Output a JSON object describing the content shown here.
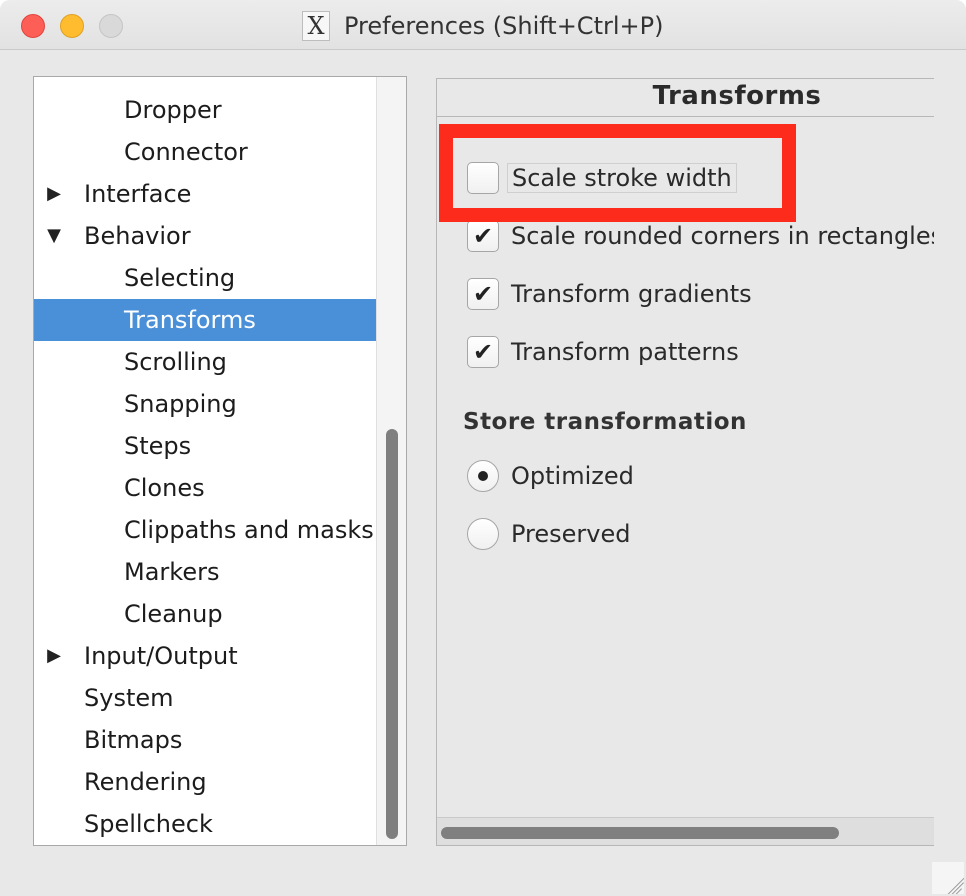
{
  "window": {
    "title": "Preferences (Shift+Ctrl+P)",
    "app_icon_glyph": "X"
  },
  "tree": {
    "items": [
      {
        "label": "Dropper",
        "indent": 2,
        "arrow": "",
        "selected": false
      },
      {
        "label": "Connector",
        "indent": 2,
        "arrow": "",
        "selected": false
      },
      {
        "label": "Interface",
        "indent": 1,
        "arrow": "collapsed",
        "selected": false
      },
      {
        "label": "Behavior",
        "indent": 1,
        "arrow": "expanded",
        "selected": false
      },
      {
        "label": "Selecting",
        "indent": 2,
        "arrow": "",
        "selected": false
      },
      {
        "label": "Transforms",
        "indent": 2,
        "arrow": "",
        "selected": true
      },
      {
        "label": "Scrolling",
        "indent": 2,
        "arrow": "",
        "selected": false
      },
      {
        "label": "Snapping",
        "indent": 2,
        "arrow": "",
        "selected": false
      },
      {
        "label": "Steps",
        "indent": 2,
        "arrow": "",
        "selected": false
      },
      {
        "label": "Clones",
        "indent": 2,
        "arrow": "",
        "selected": false
      },
      {
        "label": "Clippaths and masks",
        "indent": 2,
        "arrow": "",
        "selected": false
      },
      {
        "label": "Markers",
        "indent": 2,
        "arrow": "",
        "selected": false
      },
      {
        "label": "Cleanup",
        "indent": 2,
        "arrow": "",
        "selected": false
      },
      {
        "label": "Input/Output",
        "indent": 1,
        "arrow": "collapsed",
        "selected": false
      },
      {
        "label": "System",
        "indent": 1,
        "arrow": "",
        "selected": false
      },
      {
        "label": "Bitmaps",
        "indent": 1,
        "arrow": "",
        "selected": false
      },
      {
        "label": "Rendering",
        "indent": 1,
        "arrow": "",
        "selected": false
      },
      {
        "label": "Spellcheck",
        "indent": 1,
        "arrow": "",
        "selected": false
      }
    ]
  },
  "content": {
    "title": "Transforms",
    "checkboxes": [
      {
        "label": "Scale stroke width",
        "checked": false,
        "focused": true
      },
      {
        "label": "Scale rounded corners in rectangles",
        "checked": true,
        "focused": false
      },
      {
        "label": "Transform gradients",
        "checked": true,
        "focused": false
      },
      {
        "label": "Transform patterns",
        "checked": true,
        "focused": false
      }
    ],
    "store_heading": "Store transformation",
    "radios": [
      {
        "label": "Optimized",
        "selected": true
      },
      {
        "label": "Preserved",
        "selected": false
      }
    ]
  },
  "colors": {
    "selection": "#4a90d9",
    "highlight": "#fc2b1c",
    "close": "#fd5f57",
    "minimize": "#febc2e",
    "zoom_inactive": "#d9d9d9"
  }
}
